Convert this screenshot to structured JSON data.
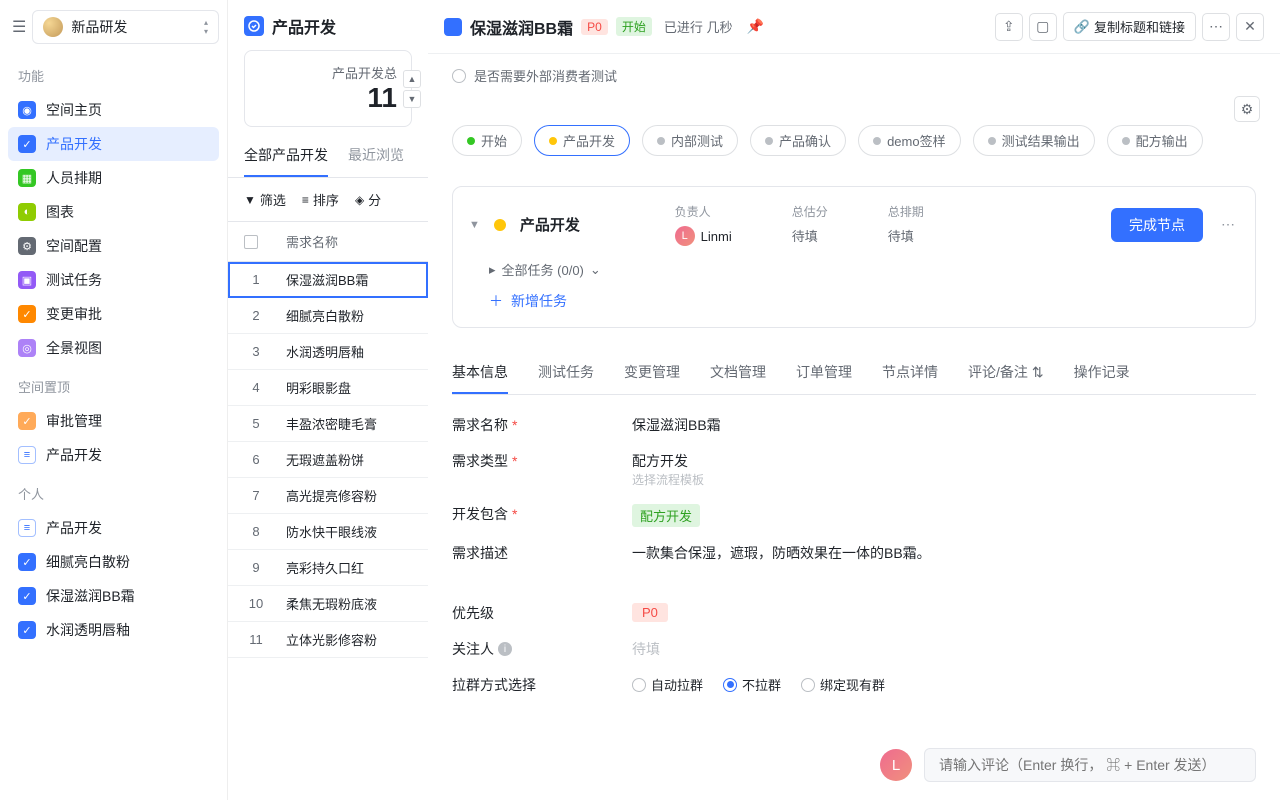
{
  "workspace": {
    "name": "新品研发"
  },
  "sidebar": {
    "sections": {
      "func": "功能",
      "pinned": "空间置顶",
      "personal": "个人"
    },
    "func_items": [
      {
        "label": "空间主页",
        "icon_cls": "ic-blue"
      },
      {
        "label": "产品开发",
        "icon_cls": "ic-blue"
      },
      {
        "label": "人员排期",
        "icon_cls": "ic-green"
      },
      {
        "label": "图表",
        "icon_cls": "ic-lime"
      },
      {
        "label": "空间配置",
        "icon_cls": "ic-gray"
      },
      {
        "label": "测试任务",
        "icon_cls": "ic-purple"
      },
      {
        "label": "变更审批",
        "icon_cls": "ic-orange"
      },
      {
        "label": "全景视图",
        "icon_cls": "ic-lpurple"
      }
    ],
    "pinned_items": [
      {
        "label": "审批管理",
        "icon_cls": "ic-lorange"
      },
      {
        "label": "产品开发",
        "icon_cls": "ic-lblue"
      }
    ],
    "personal_items": [
      {
        "label": "产品开发",
        "icon_cls": "ic-lblue"
      },
      {
        "label": "细腻亮白散粉",
        "icon_cls": "ic-sblue"
      },
      {
        "label": "保湿滋润BB霜",
        "icon_cls": "ic-sblue"
      },
      {
        "label": "水润透明唇釉",
        "icon_cls": "ic-sblue"
      }
    ]
  },
  "mid": {
    "title": "产品开发",
    "stat_label": "产品开发总",
    "stat_value": "11",
    "tabs": {
      "all": "全部产品开发",
      "recent": "最近浏览"
    },
    "filters": {
      "filter": "筛选",
      "sort": "排序",
      "group": "分"
    },
    "col_header": "需求名称",
    "rows": [
      {
        "num": "1",
        "name": "保湿滋润BB霜"
      },
      {
        "num": "2",
        "name": "细腻亮白散粉"
      },
      {
        "num": "3",
        "name": "水润透明唇釉"
      },
      {
        "num": "4",
        "name": "明彩眼影盘"
      },
      {
        "num": "5",
        "name": "丰盈浓密睫毛膏"
      },
      {
        "num": "6",
        "name": "无瑕遮盖粉饼"
      },
      {
        "num": "7",
        "name": "高光提亮修容粉"
      },
      {
        "num": "8",
        "name": "防水快干眼线液"
      },
      {
        "num": "9",
        "name": "亮彩持久口红"
      },
      {
        "num": "10",
        "name": "柔焦无瑕粉底液"
      },
      {
        "num": "11",
        "name": "立体光影修容粉"
      }
    ]
  },
  "detail": {
    "title": "保湿滋润BB霜",
    "priority": "P0",
    "status_tag": "开始",
    "status_text": "已进行 几秒",
    "copy_link": "复制标题和链接",
    "consumer_test_label": "是否需要外部消费者测试",
    "workflow": [
      {
        "label": "开始",
        "dot": "dot-green",
        "cls": "done"
      },
      {
        "label": "产品开发",
        "dot": "dot-yellow",
        "cls": "active"
      },
      {
        "label": "内部测试",
        "dot": "dot-gray",
        "cls": ""
      },
      {
        "label": "产品确认",
        "dot": "dot-gray",
        "cls": ""
      },
      {
        "label": "demo签样",
        "dot": "dot-gray",
        "cls": ""
      },
      {
        "label": "测试结果输出",
        "dot": "dot-gray",
        "cls": ""
      },
      {
        "label": "配方输出",
        "dot": "dot-gray",
        "cls": ""
      }
    ],
    "node": {
      "name": "产品开发",
      "labels": {
        "assignee": "负责人",
        "points": "总估分",
        "schedule": "总排期"
      },
      "assignee": "Linmi",
      "points": "待填",
      "schedule": "待填",
      "subtasks_label": "全部任务 (0/0)",
      "add_task": "新增任务",
      "finish_btn": "完成节点"
    },
    "tabs": [
      {
        "label": "基本信息"
      },
      {
        "label": "测试任务"
      },
      {
        "label": "变更管理"
      },
      {
        "label": "文档管理"
      },
      {
        "label": "订单管理"
      },
      {
        "label": "节点详情"
      },
      {
        "label": "评论/备注"
      },
      {
        "label": "操作记录"
      }
    ],
    "info": {
      "name_label": "需求名称",
      "name_val": "保湿滋润BB霜",
      "type_label": "需求类型",
      "type_val": "配方开发",
      "template_placeholder": "选择流程模板",
      "include_label": "开发包含",
      "include_val": "配方开发",
      "desc_label": "需求描述",
      "desc_val": "一款集合保湿，遮瑕，防晒效果在一体的BB霜。",
      "priority_label": "优先级",
      "priority_val": "P0",
      "follower_label": "关注人",
      "follower_val": "待填",
      "group_mode_label": "拉群方式选择",
      "group_options": {
        "auto": "自动拉群",
        "none": "不拉群",
        "bind": "绑定现有群"
      }
    },
    "comment_placeholder": "请输入评论（Enter 换行， ⌘ + Enter 发送）",
    "comment_avatar": "L"
  }
}
